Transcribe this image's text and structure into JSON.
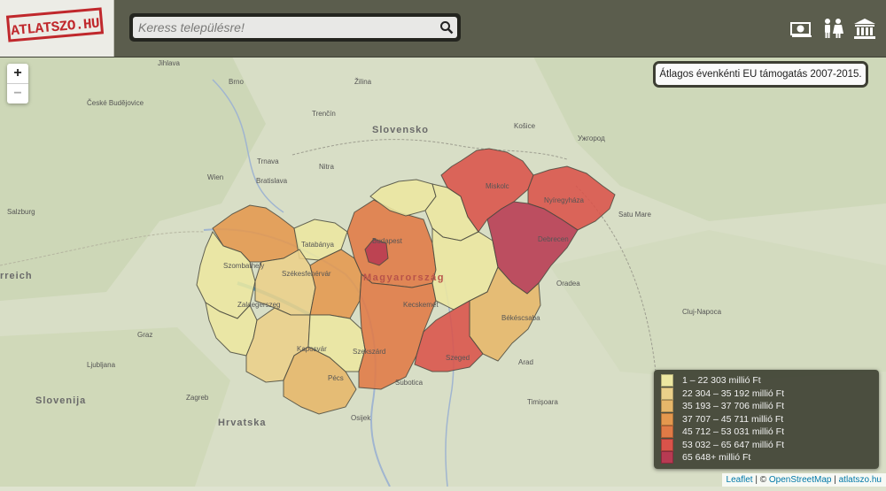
{
  "header": {
    "logo_text": "ATLATSZO.HU",
    "search": {
      "placeholder": "Keress településre!"
    },
    "icons": [
      "money-icon",
      "people-icon",
      "institution-icon"
    ]
  },
  "map": {
    "title": "Átlagos évenkénti EU támogatás 2007-2015.",
    "zoom_in": "+",
    "zoom_out": "−",
    "country_labels": [
      "Slovensko",
      "Magyarország",
      "Hrvatska",
      "Slovenija",
      "rreich"
    ],
    "city_labels": [
      "Jihlava",
      "Brno",
      "České Budějovice",
      "Wien",
      "Bratislava",
      "Salzburg",
      "Graz",
      "Ljubljana",
      "Zagreb",
      "Miskolc",
      "Nyíregyháza",
      "Debrecen",
      "Budapest",
      "Szombathely",
      "Székesfehérvár",
      "Zalaegerszeg",
      "Pécs",
      "Kaposvár",
      "Szekszárd",
      "Szeged",
      "Békéscsaba",
      "Oradea",
      "Satu Mare",
      "Cluj-Napoca",
      "Arad",
      "Timișoara",
      "Subotica",
      "Osijek",
      "Tatabánya",
      "Kecskemét",
      "Ужгород",
      "Trenčín",
      "Trnava",
      "Nitra",
      "Žilina",
      "Košice"
    ],
    "choropleth_colors": {
      "c1": "#ece7a1",
      "c2": "#ead08a",
      "c3": "#e6b76a",
      "c4": "#e4984e",
      "c5": "#e07a46",
      "c6": "#d9534a",
      "c7": "#b73a52"
    }
  },
  "legend": {
    "items": [
      {
        "label": "1 – 22 303 millió Ft",
        "color": "#ece7a1"
      },
      {
        "label": "22 304 – 35 192 millió Ft",
        "color": "#ead08a"
      },
      {
        "label": "35 193 – 37 706 millió Ft",
        "color": "#e6b76a"
      },
      {
        "label": "37 707 – 45 711 millió Ft",
        "color": "#e4984e"
      },
      {
        "label": "45 712 – 53 031 millió Ft",
        "color": "#e07a46"
      },
      {
        "label": "53 032 – 65 647 millió Ft",
        "color": "#d9534a"
      },
      {
        "label": "65 648+ millió Ft",
        "color": "#b73a52"
      }
    ]
  },
  "attribution": {
    "leaflet": "Leaflet",
    "sep1": " | © ",
    "osm": "OpenStreetMap",
    "sep2": " | ",
    "site": "atlatszo.hu"
  }
}
